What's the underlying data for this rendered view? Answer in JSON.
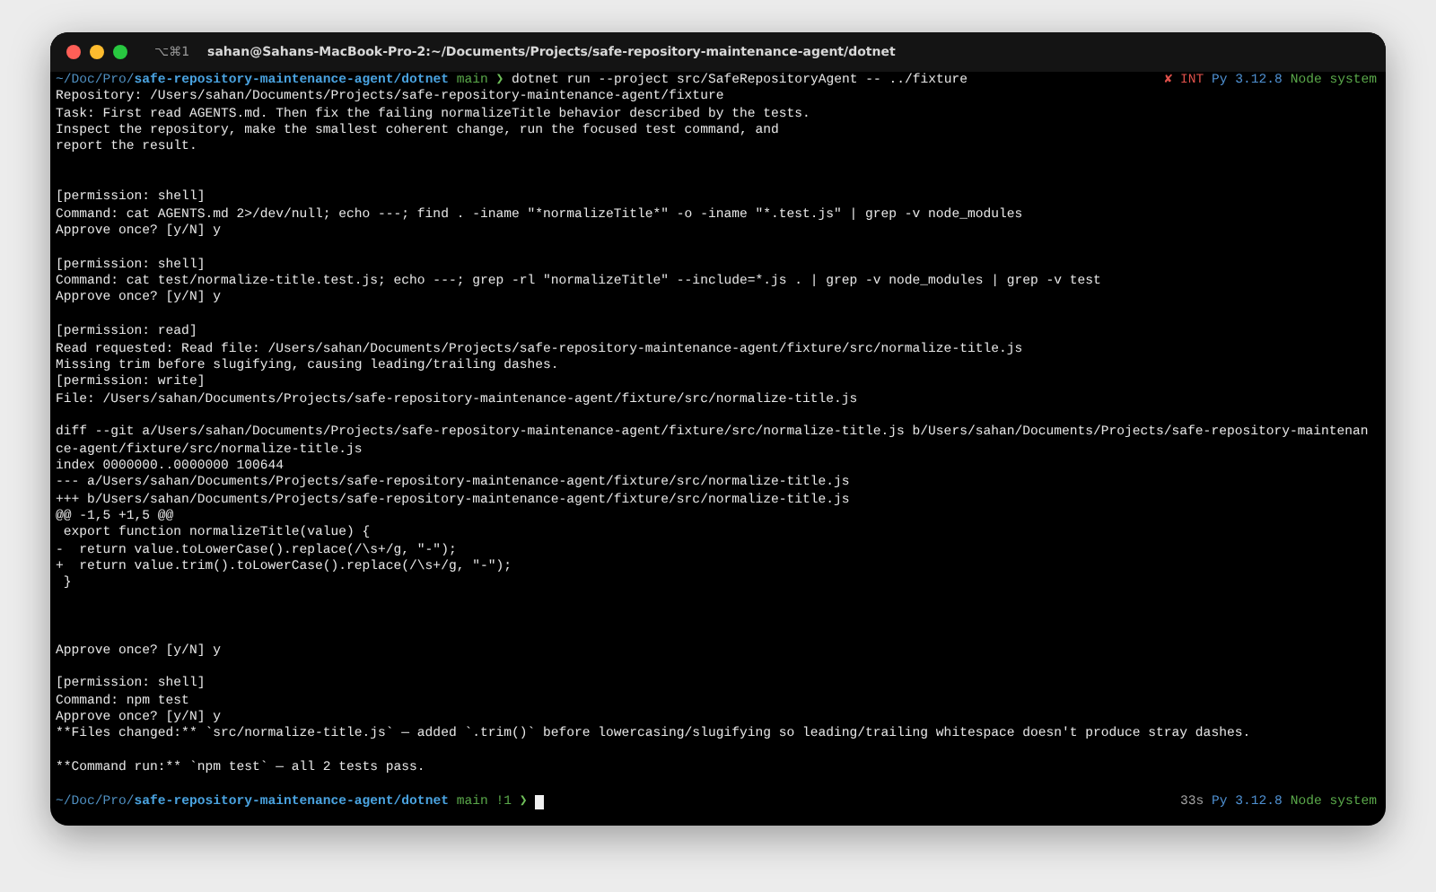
{
  "window": {
    "shortcut": "⌥⌘1",
    "title": "sahan@Sahans-MacBook-Pro-2:~/Documents/Projects/safe-repository-maintenance-agent/dotnet"
  },
  "lines": [
    {
      "kind": "prompt",
      "path_dim": "~/Doc/Pro/",
      "path_bold": "safe-repository-maintenance-agent/dotnet",
      "branch": "main",
      "symbol": "❯",
      "command": "dotnet run --project src/SafeRepositoryAgent -- ../fixture",
      "right": [
        {
          "text": "✘ INT",
          "color": "#e0514b"
        },
        {
          "text": "Py 3.12.8",
          "color": "#4e8fd0"
        },
        {
          "text": "Node system",
          "color": "#5aa84a"
        }
      ]
    },
    {
      "kind": "text",
      "text": "Repository: /Users/sahan/Documents/Projects/safe-repository-maintenance-agent/fixture"
    },
    {
      "kind": "text",
      "text": "Task: First read AGENTS.md. Then fix the failing normalizeTitle behavior described by the tests."
    },
    {
      "kind": "text",
      "text": "Inspect the repository, make the smallest coherent change, run the focused test command, and"
    },
    {
      "kind": "text",
      "text": "report the result."
    },
    {
      "kind": "blank"
    },
    {
      "kind": "blank"
    },
    {
      "kind": "text",
      "text": "[permission: shell]"
    },
    {
      "kind": "text",
      "text": "Command: cat AGENTS.md 2>/dev/null; echo ---; find . -iname \"*normalizeTitle*\" -o -iname \"*.test.js\" | grep -v node_modules"
    },
    {
      "kind": "text",
      "text": "Approve once? [y/N] y"
    },
    {
      "kind": "blank"
    },
    {
      "kind": "text",
      "text": "[permission: shell]"
    },
    {
      "kind": "text",
      "text": "Command: cat test/normalize-title.test.js; echo ---; grep -rl \"normalizeTitle\" --include=*.js . | grep -v node_modules | grep -v test"
    },
    {
      "kind": "text",
      "text": "Approve once? [y/N] y"
    },
    {
      "kind": "blank"
    },
    {
      "kind": "text",
      "text": "[permission: read]"
    },
    {
      "kind": "text",
      "text": "Read requested: Read file: /Users/sahan/Documents/Projects/safe-repository-maintenance-agent/fixture/src/normalize-title.js"
    },
    {
      "kind": "text",
      "text": "Missing trim before slugifying, causing leading/trailing dashes."
    },
    {
      "kind": "text",
      "text": "[permission: write]"
    },
    {
      "kind": "text",
      "text": "File: /Users/sahan/Documents/Projects/safe-repository-maintenance-agent/fixture/src/normalize-title.js"
    },
    {
      "kind": "blank"
    },
    {
      "kind": "text",
      "text": "diff --git a/Users/sahan/Documents/Projects/safe-repository-maintenance-agent/fixture/src/normalize-title.js b/Users/sahan/Documents/Projects/safe-repository-maintenan"
    },
    {
      "kind": "text",
      "text": "ce-agent/fixture/src/normalize-title.js"
    },
    {
      "kind": "text",
      "text": "index 0000000..0000000 100644"
    },
    {
      "kind": "text",
      "text": "--- a/Users/sahan/Documents/Projects/safe-repository-maintenance-agent/fixture/src/normalize-title.js"
    },
    {
      "kind": "text",
      "text": "+++ b/Users/sahan/Documents/Projects/safe-repository-maintenance-agent/fixture/src/normalize-title.js"
    },
    {
      "kind": "text",
      "text": "@@ -1,5 +1,5 @@"
    },
    {
      "kind": "text",
      "text": " export function normalizeTitle(value) {"
    },
    {
      "kind": "text",
      "text": "-  return value.toLowerCase().replace(/\\s+/g, \"-\");"
    },
    {
      "kind": "text",
      "text": "+  return value.trim().toLowerCase().replace(/\\s+/g, \"-\");"
    },
    {
      "kind": "text",
      "text": " }"
    },
    {
      "kind": "blank"
    },
    {
      "kind": "blank"
    },
    {
      "kind": "blank"
    },
    {
      "kind": "text",
      "text": "Approve once? [y/N] y"
    },
    {
      "kind": "blank"
    },
    {
      "kind": "text",
      "text": "[permission: shell]"
    },
    {
      "kind": "text",
      "text": "Command: npm test"
    },
    {
      "kind": "text",
      "text": "Approve once? [y/N] y"
    },
    {
      "kind": "text",
      "text": "**Files changed:** `src/normalize-title.js` — added `.trim()` before lowercasing/slugifying so leading/trailing whitespace doesn't produce stray dashes."
    },
    {
      "kind": "blank"
    },
    {
      "kind": "text",
      "text": "**Command run:** `npm test` — all 2 tests pass."
    },
    {
      "kind": "blank"
    },
    {
      "kind": "prompt",
      "path_dim": "~/Doc/Pro/",
      "path_bold": "safe-repository-maintenance-agent/dotnet",
      "branch": "main",
      "git_status": "!1",
      "symbol": "❯",
      "cursor": true,
      "right": [
        {
          "text": "33s",
          "color": "#a0a0a0"
        },
        {
          "text": "Py 3.12.8",
          "color": "#4e8fd0"
        },
        {
          "text": "Node system",
          "color": "#5aa84a"
        }
      ]
    }
  ]
}
